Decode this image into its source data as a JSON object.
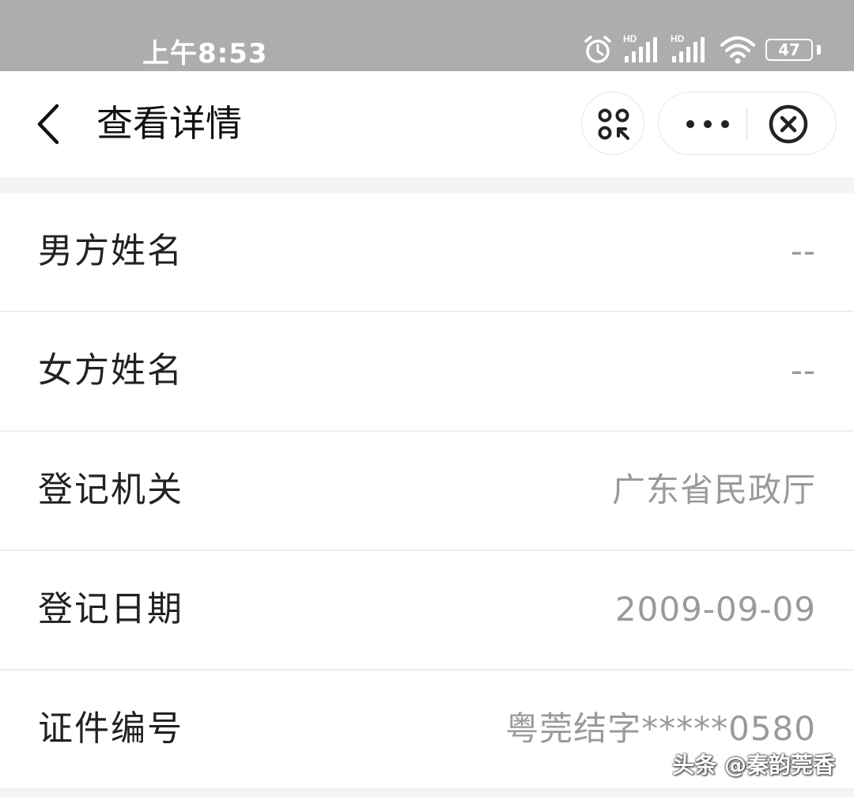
{
  "status_bar": {
    "time": "上午8:53",
    "hd_label_1": "HD",
    "hd_label_2": "HD",
    "battery_level": "47",
    "icons": [
      "alarm-icon",
      "signal-icon",
      "signal-icon",
      "wifi-icon",
      "battery-icon"
    ]
  },
  "nav": {
    "title": "查看详情",
    "back_icon": "chevron-left-icon",
    "scan_icon": "scan-code-icon",
    "more_icon": "more-dots-icon",
    "close_icon": "close-circle-icon"
  },
  "details": [
    {
      "label": "男方姓名",
      "value": "--"
    },
    {
      "label": "女方姓名",
      "value": "--"
    },
    {
      "label": "登记机关",
      "value": "广东省民政厅"
    },
    {
      "label": "登记日期",
      "value": "2009-09-09"
    },
    {
      "label": "证件编号",
      "value": "粤莞结字*****0580"
    }
  ],
  "watermark": "头条 @秦韵莞香",
  "colors": {
    "status_bar_bg": "#adadad",
    "page_bg": "#f4f4f4",
    "label_text": "#222222",
    "value_text": "#9a9a9a"
  }
}
